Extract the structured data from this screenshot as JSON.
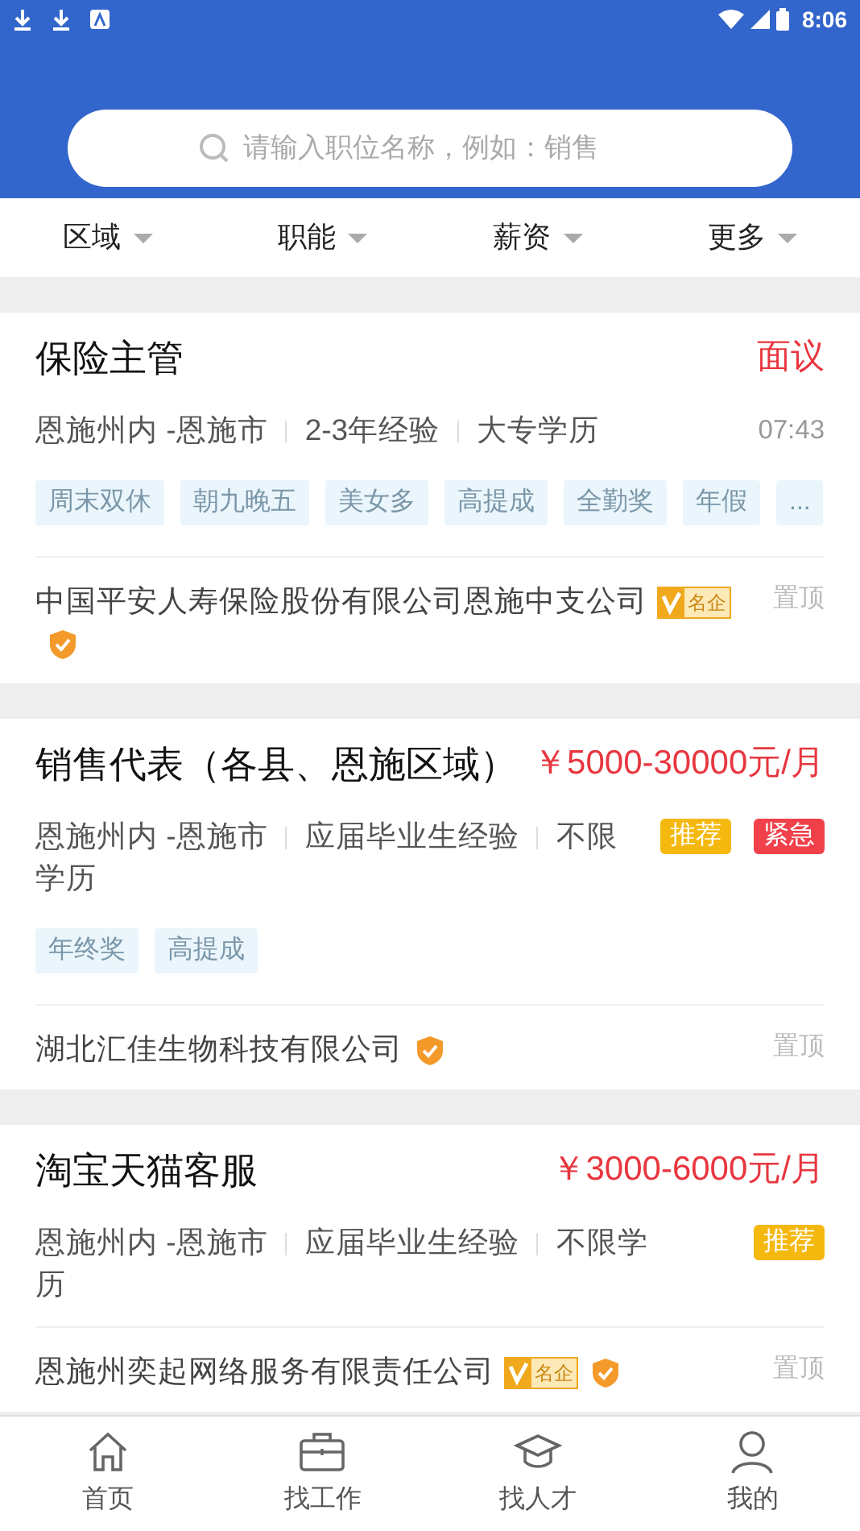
{
  "status_bar": {
    "time": "8:06"
  },
  "search": {
    "placeholder": "请输入职位名称，例如：销售"
  },
  "filters": [
    {
      "label": "区域"
    },
    {
      "label": "职能"
    },
    {
      "label": "薪资"
    },
    {
      "label": "更多"
    }
  ],
  "jobs": [
    {
      "title": "保险主管",
      "salary": "面议",
      "meta": [
        "恩施州内 -恩施市",
        "2-3年经验",
        "大专学历"
      ],
      "time": "07:43",
      "tags": [
        "周末双休",
        "朝九晚五",
        "美女多",
        "高提成",
        "全勤奖",
        "年假",
        "..."
      ],
      "company": "中国平安人寿保险股份有限公司恩施中支公司",
      "famous": true,
      "famous_label": "名企",
      "verified": true,
      "pin": "置顶"
    },
    {
      "title": "销售代表（各县、恩施区域）",
      "salary": "￥5000-30000元/月",
      "meta": [
        "恩施州内 -恩施市",
        "应届毕业生经验",
        "不限学历"
      ],
      "badges": [
        {
          "kind": "recommend",
          "label": "推荐"
        },
        {
          "kind": "urgent",
          "label": "紧急"
        }
      ],
      "tags": [
        "年终奖",
        "高提成"
      ],
      "company": "湖北汇佳生物科技有限公司",
      "famous": false,
      "verified": true,
      "pin": "置顶"
    },
    {
      "title": "淘宝天猫客服",
      "salary": "￥3000-6000元/月",
      "meta": [
        "恩施州内 -恩施市",
        "应届毕业生经验",
        "不限学历"
      ],
      "badges": [
        {
          "kind": "recommend",
          "label": "推荐"
        }
      ],
      "company": "恩施州奕起网络服务有限责任公司",
      "famous": true,
      "famous_label": "名企",
      "verified": true,
      "pin": "置顶"
    }
  ],
  "nav": [
    {
      "kind": "home",
      "label": "首页"
    },
    {
      "kind": "briefcase",
      "label": "找工作"
    },
    {
      "kind": "cap",
      "label": "找人才"
    },
    {
      "kind": "person",
      "label": "我的"
    }
  ]
}
